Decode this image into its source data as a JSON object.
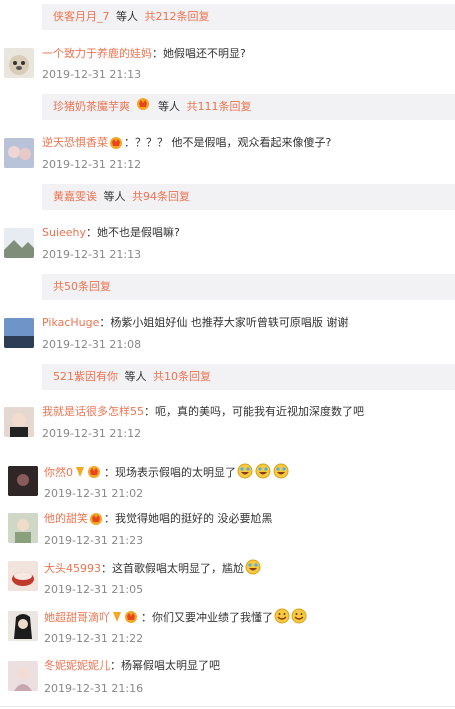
{
  "replies": [
    {
      "user": "侠客月月_7",
      "mid": "等人",
      "count": "共212条回复",
      "vip": false
    },
    {
      "user": "珍猪奶茶魔芋爽",
      "mid": "等人",
      "count": "共111条回复",
      "vip": true
    },
    {
      "user": "黄嘉雯诶",
      "mid": "等人",
      "count": "共94条回复",
      "vip": false
    },
    {
      "user": "",
      "mid": "",
      "count": "共50条回复",
      "vip": false
    },
    {
      "user": "521紫因有你",
      "mid": "等人",
      "count": "共10条回复",
      "vip": false
    }
  ],
  "comments": [
    {
      "user": "一个致力于养鹿的娃妈",
      "text": "：她假唱还不明显?",
      "time": "2019-12-31 21:13"
    },
    {
      "user": "逆天恐惧香菜",
      "text": "：？？？ 他不是假唱，观众看起来像傻子?",
      "time": "2019-12-31 21:12"
    },
    {
      "user": "Suieehy",
      "text": "：她不也是假唱嘛?",
      "time": "2019-12-31 21:13"
    },
    {
      "user": "PikacHuge",
      "text": "：杨紫小姐姐好仙 也推荐大家听曾轶可原唱版 谢谢",
      "time": "2019-12-31 21:08"
    },
    {
      "user": "我就是话很多怎样55",
      "text": "：呃，真的美吗，可能我有近视加深度数了吧",
      "time": "2019-12-31 21:12"
    },
    {
      "user": "你然0",
      "text": "：现场表示假唱的太明显了",
      "time": "2019-12-31 21:02"
    },
    {
      "user": "他的甜笑",
      "text": "：我觉得她唱的挺好的 没必要尬黑",
      "time": "2019-12-31 21:23"
    },
    {
      "user": "大头45993",
      "text": "：这首歌假唱太明显了，尴尬",
      "time": "2019-12-31 21:05"
    },
    {
      "user": "她超甜哥滴吖",
      "text": "：你们又要冲业绩了我懂了",
      "time": "2019-12-31 21:22"
    },
    {
      "user": "冬妮妮妮妮儿",
      "text": "：杨幂假唱太明显了吧",
      "time": "2019-12-31 21:16"
    }
  ],
  "colors": {
    "link": "#eb7350",
    "reply_bg": "#f2f2f5",
    "time": "#888888",
    "vip": "#f5a623"
  },
  "icons": {
    "vip_badge": "crown-v-icon",
    "member_badge": "member-badge-icon",
    "laugh": "laugh-cry-emoji",
    "smile": "smile-emoji"
  }
}
